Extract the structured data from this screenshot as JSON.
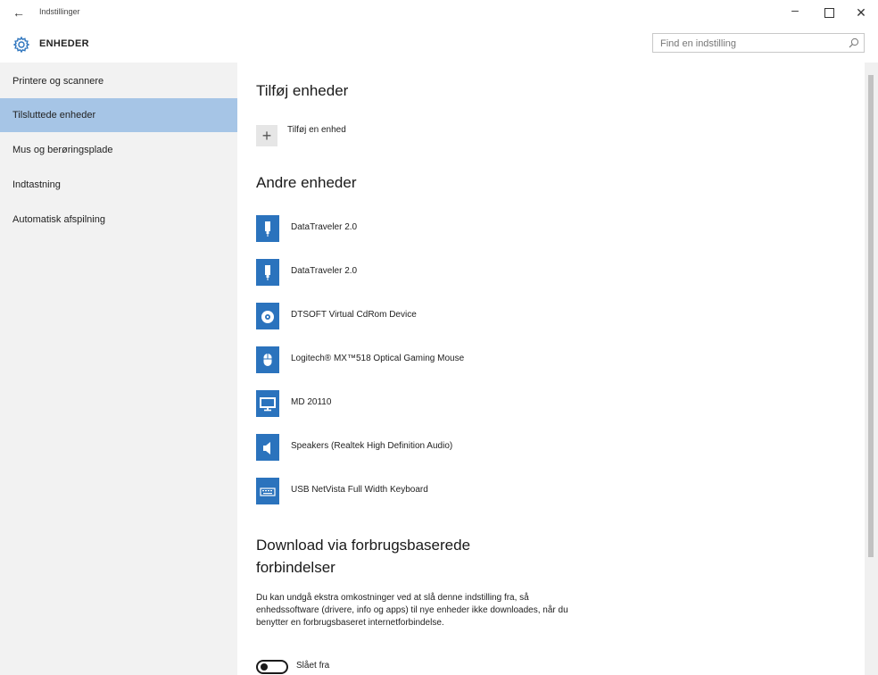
{
  "window": {
    "back_glyph": "←",
    "title": "Indstillinger",
    "min_glyph": "–",
    "close_glyph": "✕"
  },
  "header": {
    "icon": "gear-icon",
    "title": "ENHEDER",
    "search_placeholder": "Find en indstilling"
  },
  "sidebar": {
    "items": [
      {
        "label": "Printere og scannere",
        "selected": false
      },
      {
        "label": "Tilsluttede enheder",
        "selected": true
      },
      {
        "label": "Mus og berøringsplade",
        "selected": false
      },
      {
        "label": "Indtastning",
        "selected": false
      },
      {
        "label": "Automatisk afspilning",
        "selected": false
      }
    ]
  },
  "main": {
    "add_section_title": "Tilføj enheder",
    "add_glyph": "+",
    "add_label": "Tilføj en enhed",
    "other_section_title": "Andre enheder",
    "devices": [
      {
        "name": "DataTraveler 2.0",
        "icon": "usb-drive-icon"
      },
      {
        "name": "DataTraveler 2.0",
        "icon": "usb-drive-icon"
      },
      {
        "name": "DTSOFT Virtual CdRom Device",
        "icon": "disc-icon"
      },
      {
        "name": "Logitech® MX™518 Optical Gaming Mouse",
        "icon": "mouse-icon"
      },
      {
        "name": "MD 20110",
        "icon": "monitor-icon"
      },
      {
        "name": "Speakers (Realtek High Definition Audio)",
        "icon": "speaker-icon"
      },
      {
        "name": "USB NetVista Full Width Keyboard",
        "icon": "keyboard-icon"
      }
    ],
    "download_title_line1": "Download via forbrugsbaserede",
    "download_title_line2": "forbindelser",
    "download_desc": "Du kan undgå ekstra omkostninger ved at slå denne indstilling fra, så enhedssoftware (drivere, info og apps) til nye enheder ikke downloades, når du benytter en forbrugsbaseret internetforbindelse.",
    "toggle_state": "off",
    "toggle_label": "Slået fra"
  },
  "colors": {
    "accent": "#2b73bd",
    "selected_nav": "#a6c5e6",
    "sidebar_bg": "#f2f2f2"
  }
}
